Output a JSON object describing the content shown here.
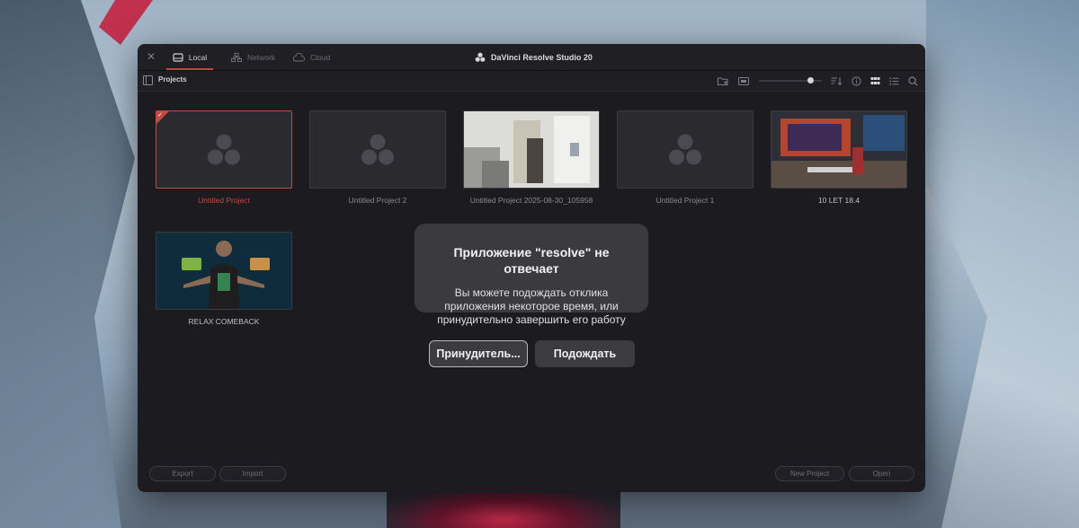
{
  "window": {
    "title": "DaVinci Resolve Studio 20",
    "tabs": [
      {
        "label": "Local",
        "icon": "drive-icon",
        "active": true
      },
      {
        "label": "Network",
        "icon": "network-icon",
        "active": false
      },
      {
        "label": "Cloud",
        "icon": "cloud-icon",
        "active": false
      }
    ]
  },
  "toolbar": {
    "label": "Projects",
    "zoom_level": 0.85
  },
  "projects": [
    {
      "title": "Untitled Project",
      "selected": true,
      "thumbnail": "resolve-logo"
    },
    {
      "title": "Untitled Project 2",
      "selected": false,
      "thumbnail": "resolve-logo"
    },
    {
      "title": "Untitled Project 2025-08-30_105958",
      "selected": false,
      "thumbnail": "photo-room"
    },
    {
      "title": "Untitled Project 1",
      "selected": false,
      "thumbnail": "resolve-logo"
    },
    {
      "title": "10 LET 18.4",
      "selected": false,
      "thumbnail": "photo-desk"
    },
    {
      "title": "RELAX COMEBACK",
      "selected": false,
      "thumbnail": "photo-relax"
    }
  ],
  "footer": {
    "export": "Export",
    "import": "Import",
    "new_project": "New Project",
    "open": "Open"
  },
  "dialog": {
    "title_line1": "Приложение \"resolve\" не",
    "title_line2": "отвечает",
    "message_line1": "Вы можете подождать отклика",
    "message_line2": "приложения некоторое время, или",
    "message_line3": "принудительно завершить его работу",
    "force_button": "Принудитель...",
    "wait_button": "Подождать"
  },
  "colors": {
    "accent": "#c24a42",
    "window_bg": "#1c1c20",
    "dialog_bg": "#3a3a3f"
  }
}
